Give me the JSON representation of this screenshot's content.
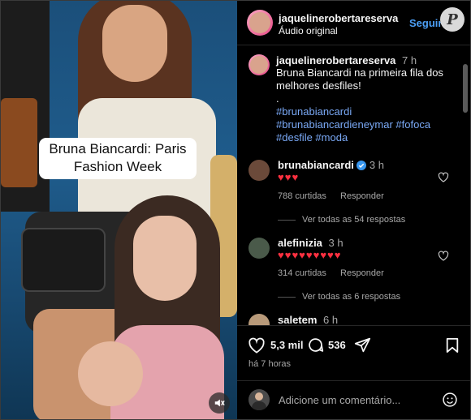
{
  "video": {
    "caption_line1": "Bruna Biancardi: Paris",
    "caption_line2": "Fashion Week",
    "mute_icon": "speaker-muted-icon"
  },
  "header": {
    "username": "jaquelinerobertareserva",
    "audio": "Áudio original",
    "follow_label": "Seguir"
  },
  "post": {
    "username": "jaquelinerobertareserva",
    "time": "7 h",
    "text_line1": "Bruna Biancardi na primeira fila dos",
    "text_line2": "melhores desfiles!",
    "text_line3": ".",
    "tag_line1": "#brunabiancardi",
    "tag_line2": "#brunabiancardieneymar #fofoca",
    "tag_line3": "#desfile #moda"
  },
  "comments": [
    {
      "username": "brunabiancardi",
      "time": "3 h",
      "hearts": "♥♥♥",
      "likes": "788 curtidas",
      "reply": "Responder",
      "view_replies": "Ver todas as 54 respostas"
    },
    {
      "username": "alefinizia",
      "time": "3 h",
      "hearts": "♥♥♥♥♥♥♥♥♥",
      "likes": "314 curtidas",
      "reply": "Responder",
      "view_replies": "Ver todas as 6 respostas"
    },
    {
      "username": "saletem",
      "time": "6 h"
    }
  ],
  "actions": {
    "likes_count": "5,3 mil",
    "comments_count": "536",
    "posted_ago": "há 7 horas"
  },
  "add_comment": {
    "placeholder": "Adicione um comentário..."
  },
  "colors": {
    "accent_blue": "#4c9ff5",
    "hashtag": "#7aa9f6",
    "heart_red": "#ff3040",
    "verified": "#3897f0"
  }
}
